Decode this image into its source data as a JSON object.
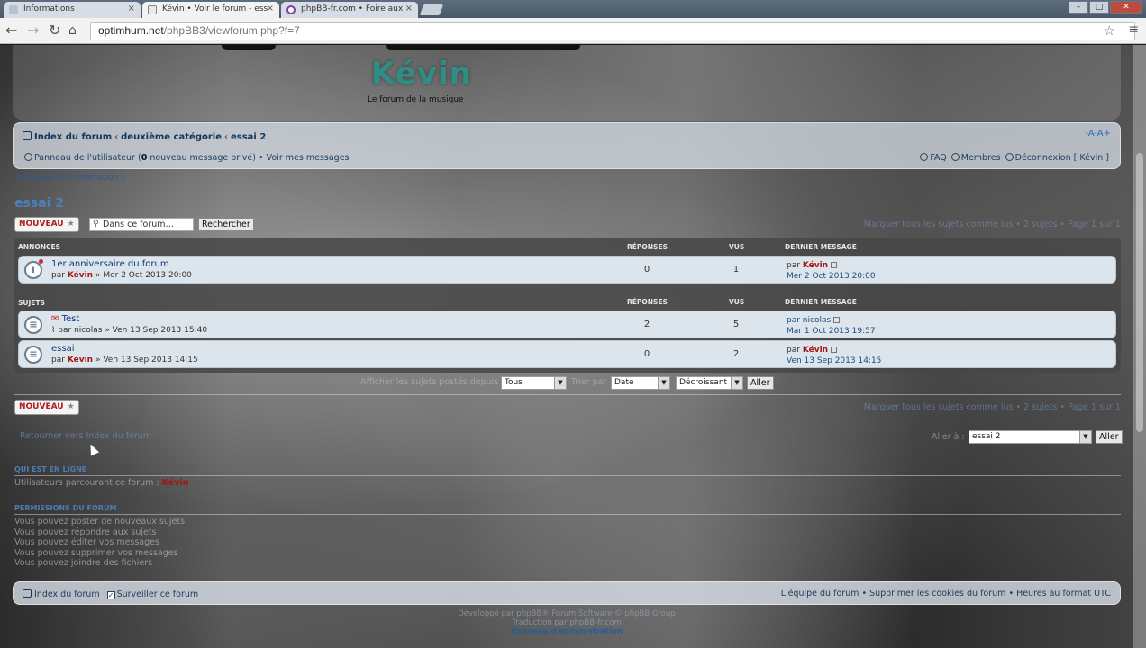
{
  "browser": {
    "tabs": [
      {
        "label": "Informations"
      },
      {
        "label": "Kévin • Voir le forum - ess"
      },
      {
        "label": "phpBB-fr.com • Foire aux"
      }
    ],
    "url_host": "optimhum.net",
    "url_path": "/phpBB3/viewforum.php?f=7",
    "close_glyph": "×"
  },
  "header": {
    "site_title": "Kévin",
    "site_tagline": "Le forum de la musique"
  },
  "navbar": {
    "crumbs": [
      "Index du forum",
      "deuxième catégorie",
      "essai 2"
    ],
    "crumb_sep": "‹",
    "font_toggle": "-A-A+",
    "ucp_prefix": "Panneau de l'utilisateur (",
    "ucp_count": "0",
    "ucp_suffix": " nouveau message privé)",
    "bullet": "•",
    "view_messages": "Voir mes messages",
    "faq": "FAQ",
    "members": "Membres",
    "logout": "Déconnexion [ Kévin ]"
  },
  "mod_link": "Panneau de modération ]",
  "forum_title": "essai 2",
  "actions": {
    "new_topic": "NOUVEAU",
    "search_placeholder": "Dans ce forum…",
    "search_button": "Rechercher",
    "pager_top": "Marquer tous les sujets comme lus • 2 sujets • Page 1 sur 1",
    "pager_bottom": "Marquer tous les sujets comme lus • 2 sujets • Page 1 sur 1"
  },
  "announcements": {
    "heading": "ANNONCES",
    "col_replies": "RÉPONSES",
    "col_views": "VUS",
    "col_last": "DERNIER MESSAGE",
    "rows": [
      {
        "title": "1er anniversaire du forum",
        "by": "par",
        "author": "Kévin",
        "date": "» Mer 2 Oct 2013 20:00",
        "replies": "0",
        "views": "1",
        "last_by": "par",
        "last_author": "Kévin",
        "last_date": "Mer 2 Oct 2013 20:00"
      }
    ]
  },
  "topics": {
    "heading": "SUJETS",
    "col_replies": "RÉPONSES",
    "col_views": "VUS",
    "col_last": "DERNIER MESSAGE",
    "rows": [
      {
        "title": "Test",
        "by": "par nicolas",
        "date": "» Ven 13 Sep 2013 15:40",
        "replies": "2",
        "views": "5",
        "last_by": "par nicolas",
        "last_date": "Mar 1 Oct 2013 19:57"
      },
      {
        "title": "essai",
        "by": "par",
        "author": "Kévin",
        "date": "» Ven 13 Sep 2013 14:15",
        "replies": "0",
        "views": "2",
        "last_by": "par",
        "last_author": "Kévin",
        "last_date": "Ven 13 Sep 2013 14:15"
      }
    ]
  },
  "sort": {
    "label_show": "Afficher les sujets postés depuis",
    "show_value": "Tous",
    "label_sort": "Trier par",
    "sort_value": "Date",
    "order_value": "Décroissant",
    "go": "Aller"
  },
  "jump": {
    "back_link": "Retourner vers Index du forum",
    "label": "Aller à :",
    "value": "essai 2",
    "go": "Aller"
  },
  "online": {
    "heading": "QUI EST EN LIGNE",
    "text": "Utilisateurs parcourant ce forum :",
    "user": "Kévin"
  },
  "permissions": {
    "heading": "PERMISSIONS DU FORUM",
    "lines": [
      "Vous pouvez poster de nouveaux sujets",
      "Vous pouvez répondre aux sujets",
      "Vous pouvez éditer vos messages",
      "Vous pouvez supprimer vos messages",
      "Vous pouvez joindre des fichiers"
    ]
  },
  "footer": {
    "index": "Index du forum",
    "watch": "Surveiller ce forum",
    "right": "L'équipe du forum • Supprimer les cookies du forum • Heures au format UTC",
    "credit1": "Développé par phpBB® Forum Software © phpBB Group",
    "credit2": "Traduction par phpBB-fr.com",
    "admin": "Panneau d'administration"
  }
}
